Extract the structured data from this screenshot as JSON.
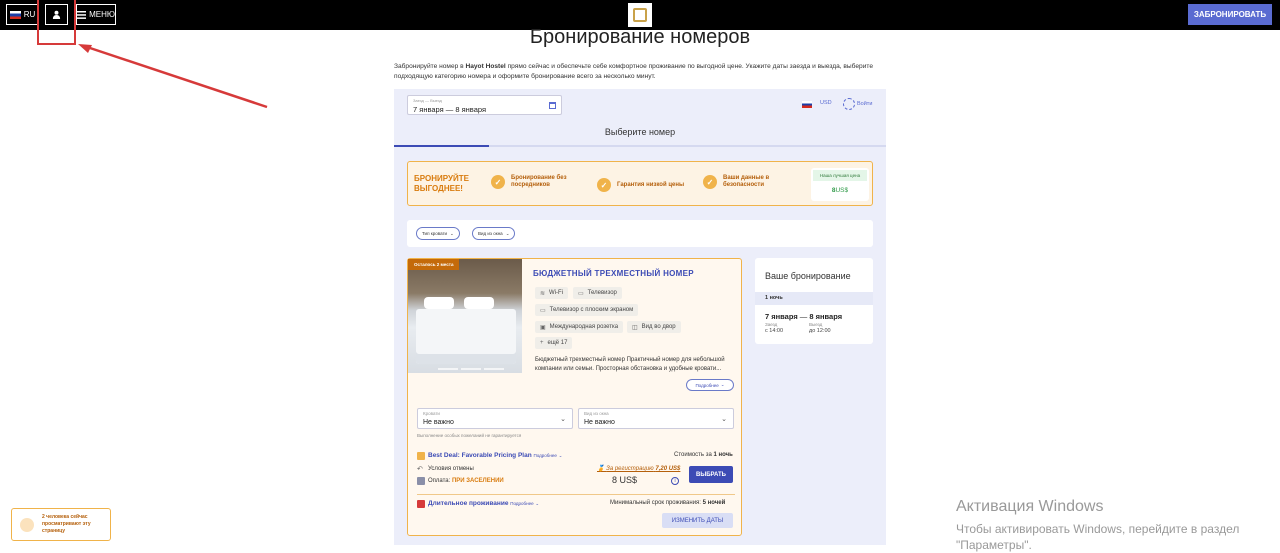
{
  "topbar": {
    "lang_label": "RU",
    "menu_label": "МЕНЮ",
    "book_label": "ЗАБРОНИРОВАТЬ"
  },
  "page": {
    "title": "Бронирование номеров",
    "intro_a": "Забронируйте номер в ",
    "intro_hotel": "Hayot Hostel",
    "intro_b": " прямо сейчас и обеспечьте себе комфортное проживание по выгодной цене. Укажите даты заезда и выезда, выберите подходящую категорию номера и оформите бронирование всего за несколько минут."
  },
  "widget": {
    "dates_label": "Заезд — Выезд",
    "dates_value": "7 января — 8 января",
    "currency": "USD",
    "login": "Войти",
    "choose_room": "Выберите номер"
  },
  "promo": {
    "headline": "БРОНИРУЙТЕ ВЫГОДНЕЕ!",
    "items": [
      "Бронирование без посредников",
      "Гарантия низкой цены",
      "Ваши данные в безопасности"
    ],
    "best_label": "Наша лучшая цена",
    "best_price_num": "8",
    "best_price_cur": "US$"
  },
  "filters": {
    "bed_type": "Тип кровати",
    "window_view": "Вид из окна"
  },
  "room": {
    "badge": "Осталось 2 места",
    "title": "БЮДЖЕТНЫЙ ТРЕХМЕСТНЫЙ НОМЕР",
    "amenities": [
      "Wi-Fi",
      "Телевизор",
      "Телевизор с плоским экраном",
      "Международная розетка",
      "Вид во двор",
      "ещё 17"
    ],
    "description": "Бюджетный трехместный номер Практичный номер для небольшой компании или семьи. Просторная обстановка и удобные кровати...",
    "more": "Подробнее",
    "bed_label": "Кровати",
    "bed_value": "Не важно",
    "view_label": "Вид из окна",
    "view_value": "Не важно",
    "note": "Выполнение особых пожеланий не гарантируется",
    "rate_name": "Best Deal: Favorable Pricing Plan",
    "rate_more": "Подробнее",
    "cancel_terms": "Условия отмены",
    "payment_label": "Оплата:",
    "payment_value": "ПРИ ЗАСЕЛЕНИИ",
    "cost_label": "Стоимость за",
    "cost_nights": "1 ночь",
    "reg_label": "За регистрацию",
    "reg_price": "7,20 US$",
    "price": "8 US$",
    "select": "ВЫБРАТЬ",
    "long_stay": "Длительное проживание",
    "long_more": "Подробнее",
    "min_stay_label": "Минимальный срок проживания:",
    "min_stay_value": "5 ночей",
    "change_dates": "ИЗМЕНИТЬ ДАТЫ"
  },
  "booking": {
    "title": "Ваше бронирование",
    "nights": "1 ночь",
    "date_from": "7 января",
    "date_to": "8 января",
    "checkin_label": "Заезд",
    "checkin_time": "с 14:00",
    "checkout_label": "Выезд",
    "checkout_time": "до 12:00"
  },
  "toast": {
    "text": "2 человека сейчас просматривают эту страницу"
  },
  "watermark": {
    "line1": "Активация Windows",
    "line2": "Чтобы активировать Windows, перейдите в раздел",
    "line3": "\"Параметры\"."
  },
  "colors": {
    "accent": "#3c4bb5",
    "book_button": "#5a6bd1",
    "promo_orange": "#f0b34a",
    "annotation_red": "#d63a3a"
  }
}
